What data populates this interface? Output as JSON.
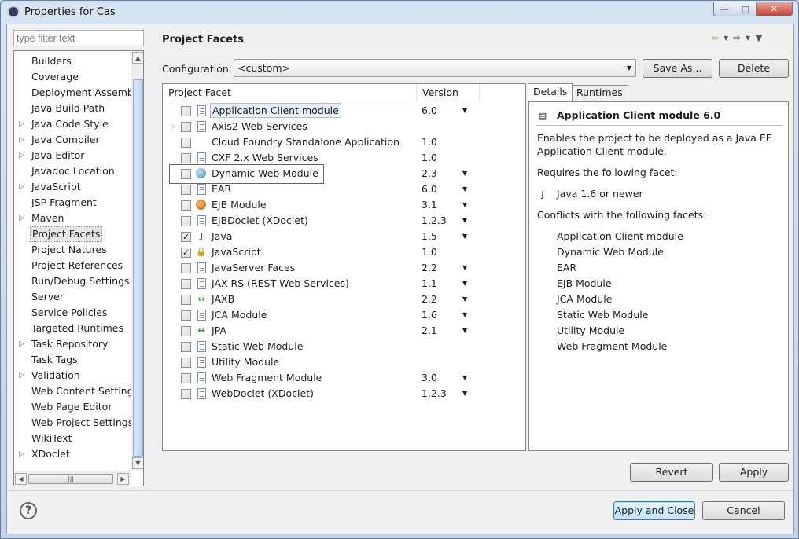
{
  "window": {
    "title": "Properties for Cas",
    "minimize": "—",
    "maximize": "□",
    "close": "✕"
  },
  "filter": {
    "placeholder": "type filter text"
  },
  "tree": {
    "items": [
      {
        "label": "Builders",
        "expandable": false
      },
      {
        "label": "Coverage",
        "expandable": false
      },
      {
        "label": "Deployment Assembly",
        "expandable": false
      },
      {
        "label": "Java Build Path",
        "expandable": false
      },
      {
        "label": "Java Code Style",
        "expandable": true
      },
      {
        "label": "Java Compiler",
        "expandable": true
      },
      {
        "label": "Java Editor",
        "expandable": true
      },
      {
        "label": "Javadoc Location",
        "expandable": false
      },
      {
        "label": "JavaScript",
        "expandable": true
      },
      {
        "label": "JSP Fragment",
        "expandable": false
      },
      {
        "label": "Maven",
        "expandable": true
      },
      {
        "label": "Project Facets",
        "expandable": false,
        "selected": true
      },
      {
        "label": "Project Natures",
        "expandable": false
      },
      {
        "label": "Project References",
        "expandable": false
      },
      {
        "label": "Run/Debug Settings",
        "expandable": false
      },
      {
        "label": "Server",
        "expandable": false
      },
      {
        "label": "Service Policies",
        "expandable": false
      },
      {
        "label": "Targeted Runtimes",
        "expandable": false
      },
      {
        "label": "Task Repository",
        "expandable": true
      },
      {
        "label": "Task Tags",
        "expandable": false
      },
      {
        "label": "Validation",
        "expandable": true
      },
      {
        "label": "Web Content Settings",
        "expandable": false
      },
      {
        "label": "Web Page Editor",
        "expandable": false
      },
      {
        "label": "Web Project Settings",
        "expandable": false
      },
      {
        "label": "WikiText",
        "expandable": false
      },
      {
        "label": "XDoclet",
        "expandable": true
      }
    ]
  },
  "page": {
    "title": "Project Facets"
  },
  "configuration": {
    "label": "Configuration:",
    "value": "<custom>",
    "save_as": "Save As...",
    "delete": "Delete"
  },
  "facets": {
    "col_facet": "Project Facet",
    "col_version": "Version",
    "rows": [
      {
        "name": "Application Client module",
        "version": "6.0",
        "dropdown": true,
        "checked": false,
        "icon": "page",
        "focused": true
      },
      {
        "name": "Axis2 Web Services",
        "version": "",
        "dropdown": false,
        "checked": false,
        "icon": "page",
        "expandable": true
      },
      {
        "name": "Cloud Foundry Standalone Application",
        "version": "1.0",
        "dropdown": false,
        "checked": false,
        "icon": "none"
      },
      {
        "name": "CXF 2.x Web Services",
        "version": "1.0",
        "dropdown": false,
        "checked": false,
        "icon": "page"
      },
      {
        "name": "Dynamic Web Module",
        "version": "2.3",
        "dropdown": true,
        "checked": false,
        "icon": "globe"
      },
      {
        "name": "EAR",
        "version": "6.0",
        "dropdown": true,
        "checked": false,
        "icon": "page"
      },
      {
        "name": "EJB Module",
        "version": "3.1",
        "dropdown": true,
        "checked": false,
        "icon": "bean"
      },
      {
        "name": "EJBDoclet (XDoclet)",
        "version": "1.2.3",
        "dropdown": true,
        "checked": false,
        "icon": "page"
      },
      {
        "name": "Java",
        "version": "1.5",
        "dropdown": true,
        "checked": true,
        "icon": "java"
      },
      {
        "name": "JavaScript",
        "version": "1.0",
        "dropdown": false,
        "checked": true,
        "icon": "js"
      },
      {
        "name": "JavaServer Faces",
        "version": "2.2",
        "dropdown": true,
        "checked": false,
        "icon": "page"
      },
      {
        "name": "JAX-RS (REST Web Services)",
        "version": "1.1",
        "dropdown": true,
        "checked": false,
        "icon": "page"
      },
      {
        "name": "JAXB",
        "version": "2.2",
        "dropdown": true,
        "checked": false,
        "icon": "arrows"
      },
      {
        "name": "JCA Module",
        "version": "1.6",
        "dropdown": true,
        "checked": false,
        "icon": "page"
      },
      {
        "name": "JPA",
        "version": "2.1",
        "dropdown": true,
        "checked": false,
        "icon": "arrows"
      },
      {
        "name": "Static Web Module",
        "version": "",
        "dropdown": false,
        "checked": false,
        "icon": "page"
      },
      {
        "name": "Utility Module",
        "version": "",
        "dropdown": false,
        "checked": false,
        "icon": "page"
      },
      {
        "name": "Web Fragment Module",
        "version": "3.0",
        "dropdown": true,
        "checked": false,
        "icon": "page"
      },
      {
        "name": "WebDoclet (XDoclet)",
        "version": "1.2.3",
        "dropdown": true,
        "checked": false,
        "icon": "page"
      }
    ]
  },
  "details": {
    "tab_details": "Details",
    "tab_runtimes": "Runtimes",
    "heading": "Application Client module 6.0",
    "description_1": "Enables the project to be deployed as a Java EE",
    "description_2": "Application Client module.",
    "requires_label": "Requires the following facet:",
    "requires": [
      {
        "name": "Java 1.6 or newer",
        "icon": "java"
      }
    ],
    "conflicts_label": "Conflicts with the following facets:",
    "conflicts": [
      {
        "name": "Application Client module",
        "icon": "page"
      },
      {
        "name": "Dynamic Web Module",
        "icon": "globe"
      },
      {
        "name": "EAR",
        "icon": "page"
      },
      {
        "name": "EJB Module",
        "icon": "bean"
      },
      {
        "name": "JCA Module",
        "icon": "page"
      },
      {
        "name": "Static Web Module",
        "icon": "page"
      },
      {
        "name": "Utility Module",
        "icon": "page"
      },
      {
        "name": "Web Fragment Module",
        "icon": "page"
      }
    ]
  },
  "buttons": {
    "revert": "Revert",
    "apply": "Apply",
    "apply_close": "Apply and Close",
    "cancel": "Cancel",
    "help": "?"
  }
}
